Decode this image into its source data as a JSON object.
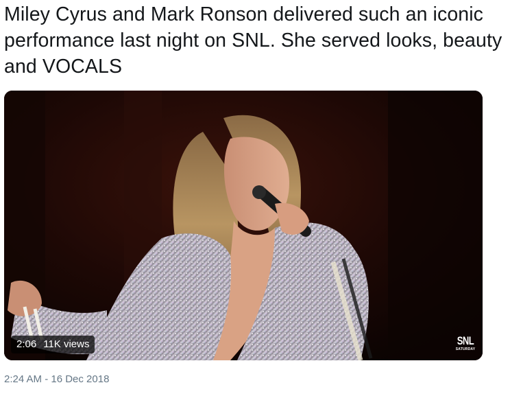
{
  "tweet": {
    "text": "Miley Cyrus and Mark Ronson delivered such an iconic performance last night on SNL. She served looks, beauty and VOCALS",
    "timestamp": "2:24 AM - 16 Dec 2018"
  },
  "video": {
    "duration": "2:06",
    "views": "11K views",
    "watermark_title": "SNL",
    "watermark_subtitle": "SATURDAY",
    "bg_color": "#1a0a06"
  },
  "colors": {
    "text": "#14171a",
    "meta": "#657786"
  }
}
